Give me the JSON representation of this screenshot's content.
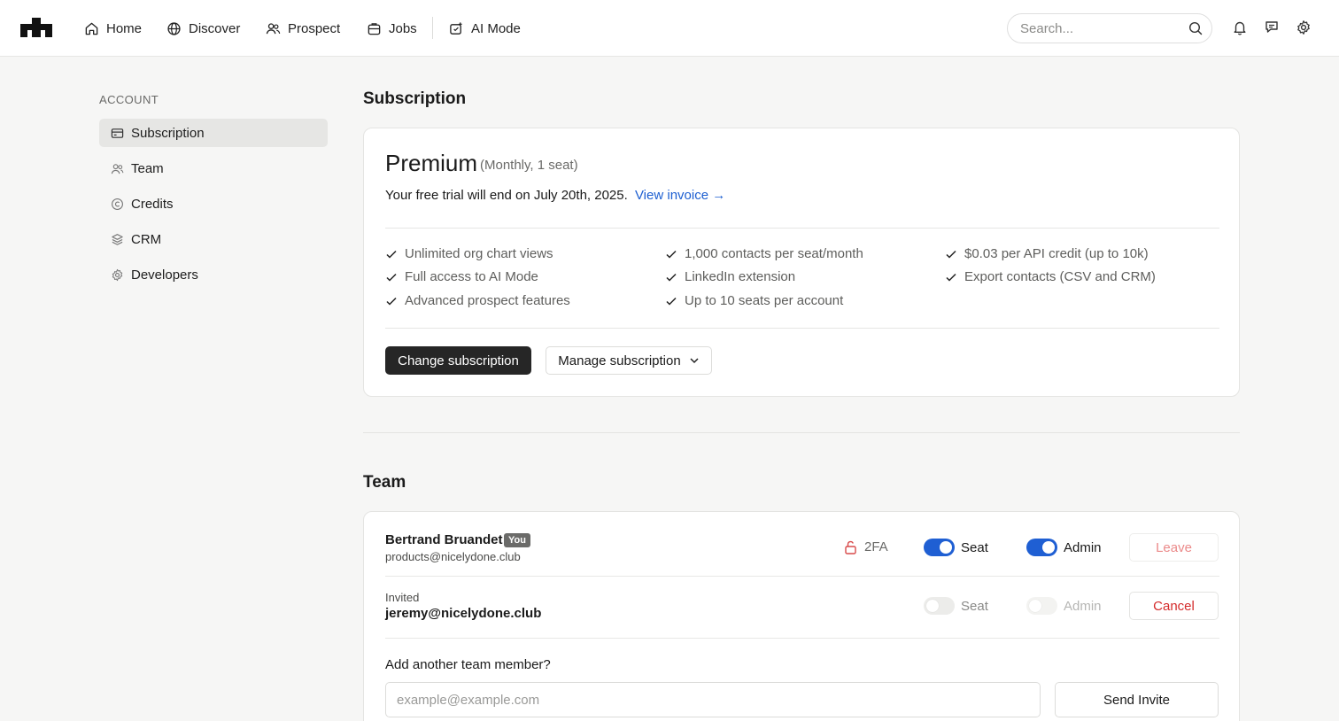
{
  "nav": {
    "logo": "logo-mark",
    "items": [
      {
        "label": "Home",
        "icon": "home-icon"
      },
      {
        "label": "Discover",
        "icon": "globe-icon"
      },
      {
        "label": "Prospect",
        "icon": "users-icon"
      },
      {
        "label": "Jobs",
        "icon": "briefcase-icon"
      },
      {
        "label": "AI Mode",
        "icon": "ai-sparkle-icon"
      }
    ],
    "search_placeholder": "Search...",
    "right_icons": [
      "bell-icon",
      "message-icon",
      "gear-icon"
    ]
  },
  "sidebar": {
    "heading": "ACCOUNT",
    "items": [
      {
        "label": "Subscription",
        "icon": "card-icon",
        "active": true
      },
      {
        "label": "Team",
        "icon": "team-icon",
        "active": false
      },
      {
        "label": "Credits",
        "icon": "credits-icon",
        "active": false
      },
      {
        "label": "CRM",
        "icon": "layers-icon",
        "active": false
      },
      {
        "label": "Developers",
        "icon": "cog-icon",
        "active": false
      }
    ]
  },
  "subscription": {
    "title": "Subscription",
    "plan": "Premium",
    "plan_meta": "(Monthly, 1 seat)",
    "trial_text": "Your free trial will end on July 20th, 2025.",
    "invoice_link": "View invoice →",
    "features": [
      "Unlimited org chart views",
      "Full access to AI Mode",
      "Advanced prospect features",
      "1,000 contacts per seat/month",
      "LinkedIn extension",
      "Up to 10 seats per account",
      "$0.03 per API credit (up to 10k)",
      "Export contacts (CSV and CRM)"
    ],
    "change_button": "Change subscription",
    "manage_button": "Manage subscription"
  },
  "team": {
    "title": "Team",
    "member": {
      "name": "Bertrand Bruandet",
      "badge": "You",
      "email": "products@nicelydone.club",
      "twofa": "2FA",
      "seat_label": "Seat",
      "seat_on": true,
      "admin_label": "Admin",
      "admin_on": true,
      "leave_button": "Leave"
    },
    "invited": {
      "status": "Invited",
      "email": "jeremy@nicelydone.club",
      "seat_label": "Seat",
      "seat_on": false,
      "admin_label": "Admin",
      "admin_on": false,
      "cancel_button": "Cancel"
    },
    "add_label": "Add another team member?",
    "input_placeholder": "example@example.com",
    "send_button": "Send Invite"
  },
  "colors": {
    "accent_blue": "#1f5fd3",
    "link_blue": "#1d5fd1",
    "danger_red": "#d42b2b",
    "dark_button": "#262626"
  }
}
